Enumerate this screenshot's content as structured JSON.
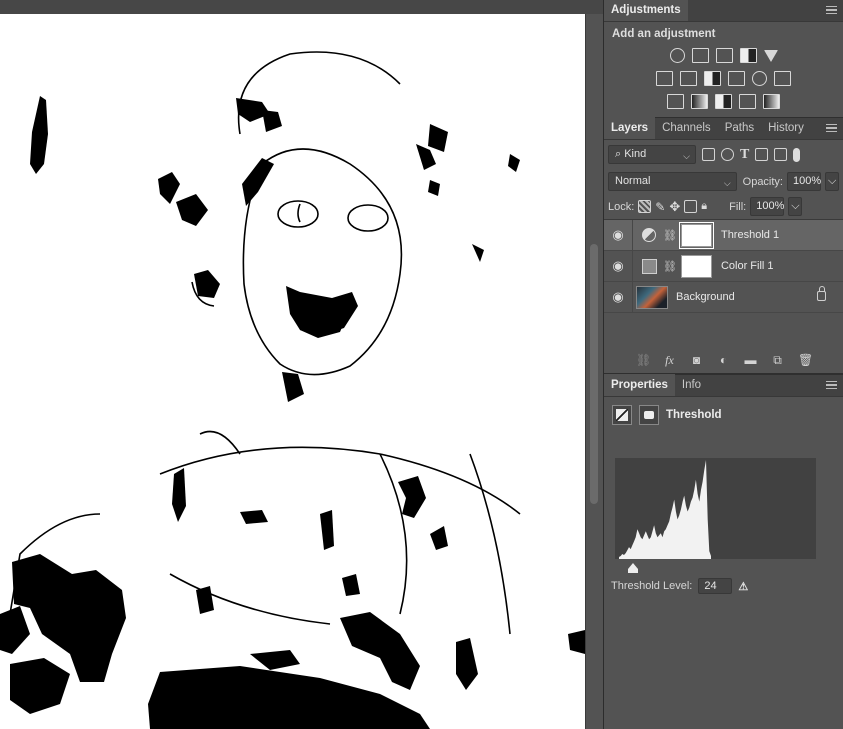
{
  "adjustments": {
    "tab": "Adjustments",
    "heading": "Add an adjustment",
    "rows": [
      [
        "brightness-contrast-icon",
        "levels-icon",
        "curves-icon",
        "exposure-icon",
        "gradient-triangle-icon"
      ],
      [
        "vibrance-icon",
        "color-balance-icon",
        "black-white-icon",
        "photo-filter-icon",
        "channel-mixer-icon",
        "color-lookup-icon"
      ],
      [
        "invert-icon",
        "posterize-icon",
        "threshold-icon",
        "selective-color-icon",
        "gradient-map-icon"
      ]
    ]
  },
  "layers_panel": {
    "tabs": [
      "Layers",
      "Channels",
      "Paths",
      "History"
    ],
    "active_tab": "Layers",
    "filter_kind": "Kind",
    "blend_mode": "Normal",
    "opacity_label": "Opacity:",
    "opacity_value": "100%",
    "lock_label": "Lock:",
    "fill_label": "Fill:",
    "fill_value": "100%",
    "layers": [
      {
        "name": "Threshold 1",
        "type": "adjustment",
        "selected": true
      },
      {
        "name": "Color Fill 1",
        "type": "fill",
        "selected": false
      },
      {
        "name": "Background",
        "type": "image",
        "selected": false,
        "locked": true
      }
    ]
  },
  "properties_panel": {
    "tabs": [
      "Properties",
      "Info"
    ],
    "active_tab": "Properties",
    "title": "Threshold",
    "threshold_label": "Threshold Level:",
    "threshold_value": "24",
    "histogram": [
      2,
      3,
      5,
      4,
      6,
      9,
      12,
      10,
      14,
      18,
      22,
      30,
      26,
      22,
      20,
      24,
      28,
      24,
      20,
      22,
      28,
      34,
      26,
      22,
      24,
      26,
      22,
      28,
      30,
      34,
      38,
      46,
      52,
      60,
      48,
      40,
      44,
      50,
      58,
      64,
      54,
      48,
      52,
      58,
      62,
      70,
      80,
      66,
      58,
      70,
      78,
      90,
      100,
      40,
      8,
      3
    ]
  },
  "colors": {
    "panel_bg": "#535353",
    "canvas": "#ffffff",
    "ink": "#000000"
  }
}
